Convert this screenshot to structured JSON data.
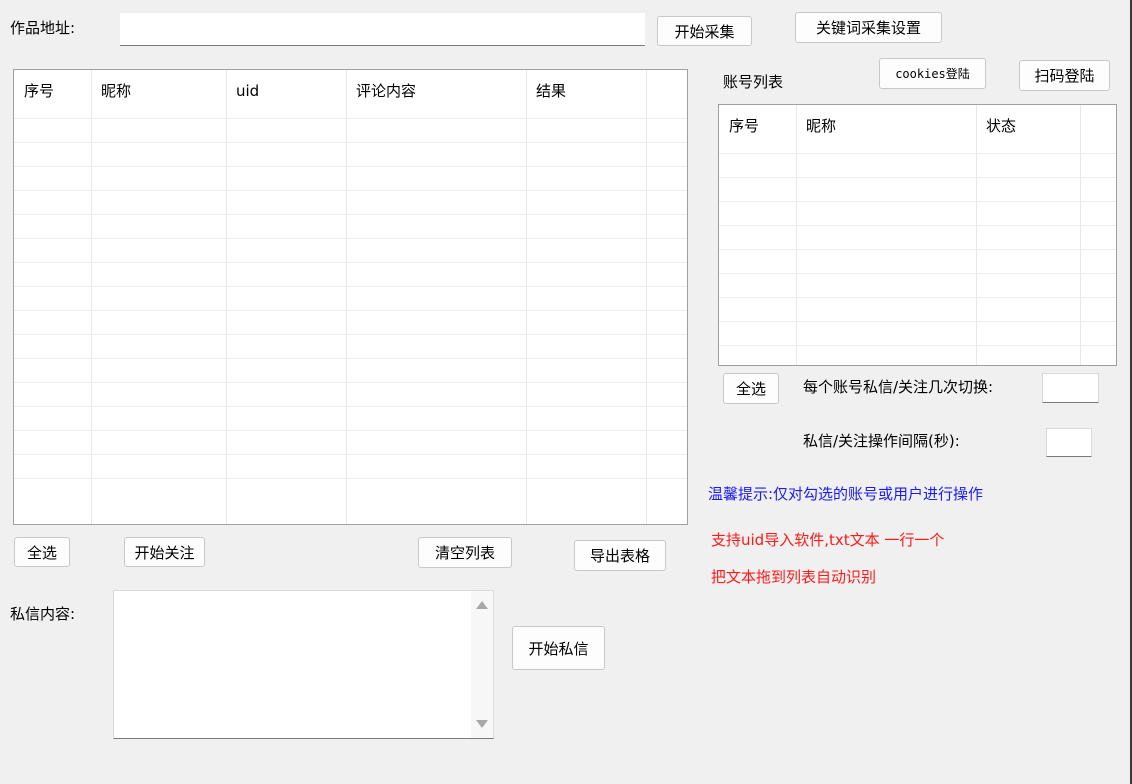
{
  "top": {
    "url_label": "作品地址:",
    "url_value": "",
    "start_collect": "开始采集",
    "keyword_settings": "关键词采集设置"
  },
  "comments_table": {
    "columns": [
      "序号",
      "昵称",
      "uid",
      "评论内容",
      "结果"
    ],
    "row_count": 16
  },
  "left_actions": {
    "select_all": "全选",
    "start_follow": "开始关注",
    "clear_list": "清空列表",
    "export_table": "导出表格"
  },
  "message": {
    "label": "私信内容:",
    "value": "",
    "start_message": "开始私信"
  },
  "accounts": {
    "title": "账号列表",
    "cookies_login": "cookies登陆",
    "scan_login": "扫码登陆",
    "columns": [
      "序号",
      "昵称",
      "状态"
    ],
    "row_count": 10,
    "select_all": "全选"
  },
  "settings": {
    "switch_label": "每个账号私信/关注几次切换:",
    "switch_value": "",
    "interval_label": "私信/关注操作间隔(秒):",
    "interval_value": ""
  },
  "notes": {
    "tip": "温馨提示:仅对勾选的账号或用户进行操作",
    "line1": "支持uid导入软件,txt文本 一行一个",
    "line2": "把文本拖到列表自动识别",
    "tip_color": "#1a1aff",
    "warn_color": "#ff1a1a"
  }
}
